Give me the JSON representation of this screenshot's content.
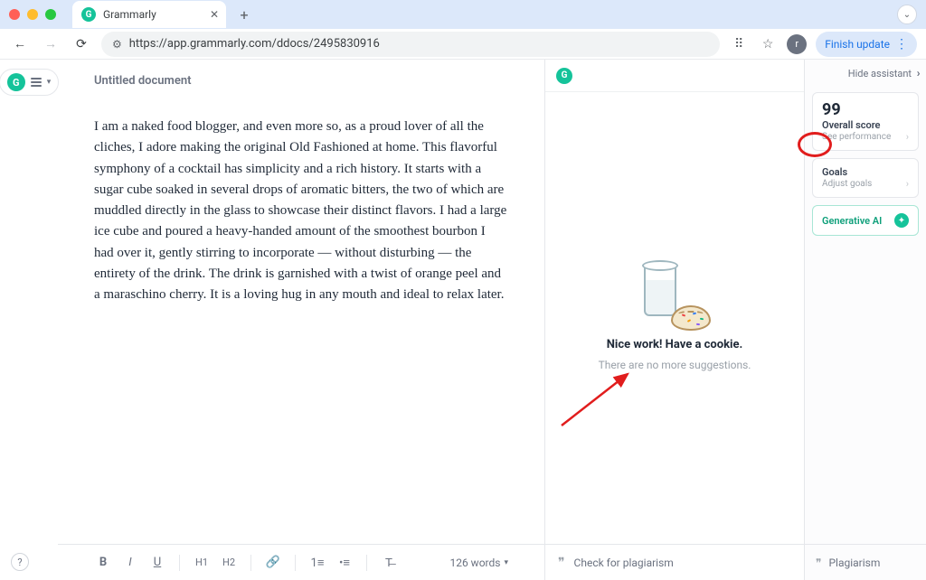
{
  "browser": {
    "tab_title": "Grammarly",
    "url": "https://app.grammarly.com/ddocs/2495830916",
    "finish_label": "Finish update",
    "avatar_initial": "r"
  },
  "document": {
    "title": "Untitled document",
    "body": "I am a naked food blogger, and even more so, as a proud lover of all the cliches, I adore making the original Old Fashioned at home. This flavorful symphony of a cocktail has simplicity and a rich history. It starts with a sugar cube soaked in several drops of aromatic bitters, the two of which are muddled directly in the glass to showcase their distinct flavors. I had a large ice cube and poured a heavy-handed amount of the smoothest bourbon I had over it, gently stirring to incorporate — without disturbing — the entirety of the drink. The drink is garnished with a twist of orange peel and a maraschino cherry. It is a loving hug in any mouth and ideal to relax later.",
    "word_count_label": "126 words"
  },
  "toolbar": {
    "bold": "B",
    "italic": "I",
    "underline": "U",
    "h1": "H1",
    "h2": "H2",
    "link": "🔗",
    "ol": "≡",
    "ul": "≣",
    "clear": "⌫"
  },
  "suggestions": {
    "headline": "Nice work! Have a cookie.",
    "sub": "There are no more suggestions.",
    "plagiarism_check": "Check for plagiarism"
  },
  "right": {
    "hide": "Hide assistant",
    "score_value": "99",
    "score_label": "Overall score",
    "score_sub": "See performance",
    "goals_label": "Goals",
    "goals_sub": "Adjust goals",
    "gen_label": "Generative AI",
    "plagiarism": "Plagiarism"
  }
}
